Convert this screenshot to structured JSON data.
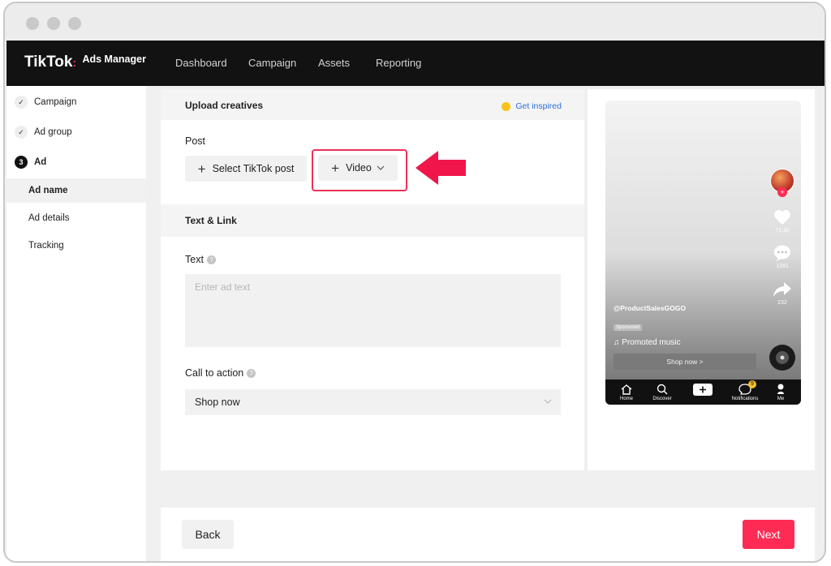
{
  "navbar": {
    "logo": "TikTok",
    "logo_colon": ":",
    "logo_sub": "Ads Manager",
    "items": [
      "Dashboard",
      "Campaign",
      "Assets",
      "Reporting"
    ]
  },
  "sidebar": {
    "steps": [
      {
        "label": "Campaign",
        "status": "done"
      },
      {
        "label": "Ad group",
        "status": "done"
      },
      {
        "label": "Ad",
        "status": "current",
        "number": "3"
      }
    ],
    "sub_items": [
      {
        "label": "Ad name",
        "active": true
      },
      {
        "label": "Ad details",
        "active": false
      },
      {
        "label": "Tracking",
        "active": false
      }
    ]
  },
  "upload": {
    "title": "Upload creatives",
    "get_inspired": "Get inspired",
    "post_label": "Post",
    "select_post_button": "Select TikTok post",
    "video_button": "Video"
  },
  "text_link": {
    "title": "Text & Link",
    "text_label": "Text",
    "text_placeholder": "Enter ad text",
    "cta_label": "Call to action",
    "cta_value": "Shop now"
  },
  "preview": {
    "username": "@ProductSalesGOGO",
    "sponsored": "Sponsored",
    "music": "♫ Promoted music",
    "shop_now": "Shop now >",
    "likes": "71.1k",
    "comments": "1281",
    "shares": "232",
    "notification_badge": "9",
    "nav": [
      "Home",
      "Discover",
      "Notifications",
      "Me"
    ]
  },
  "footer": {
    "back": "Back",
    "next": "Next"
  },
  "colors": {
    "accent": "#fe2c55",
    "navbar": "#121212",
    "link": "#2f6fd8",
    "highlight": "#ea3357"
  }
}
